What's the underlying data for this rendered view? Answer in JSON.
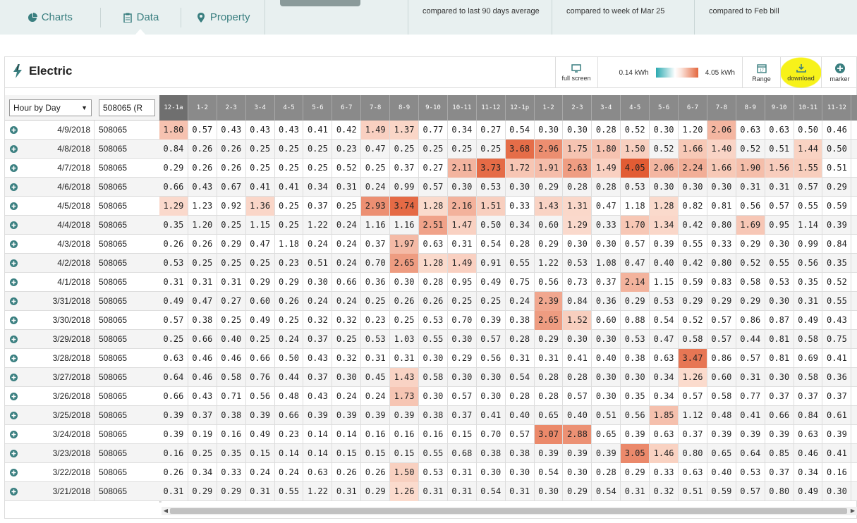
{
  "nav": {
    "tabs": [
      {
        "label": "Charts",
        "icon": "pie-chart-icon"
      },
      {
        "label": "Data",
        "icon": "clipboard-icon"
      },
      {
        "label": "Property",
        "icon": "location-pin-icon"
      }
    ],
    "active_tab": "Data"
  },
  "stats": [
    {
      "value": "",
      "caption": "compared to last 90 days average"
    },
    {
      "value": "",
      "caption": "compared to week of Mar 25"
    },
    {
      "value": "",
      "caption": "compared to Feb bill"
    }
  ],
  "panel": {
    "title": "Electric",
    "legend": {
      "min": "0.14 kWh",
      "max": "4.05 kWh",
      "low_color": "#2aa9b0",
      "high_color": "#e4673e"
    },
    "tools": {
      "fullscreen": "full screen",
      "range": "Range",
      "download": "download",
      "marker": "marker"
    }
  },
  "filters": {
    "view": "Hour by Day",
    "meter": "508065 (R"
  },
  "hours": [
    "12-1a",
    "1-2",
    "2-3",
    "3-4",
    "4-5",
    "5-6",
    "6-7",
    "7-8",
    "8-9",
    "9-10",
    "10-11",
    "11-12",
    "12-1p",
    "1-2",
    "2-3",
    "3-4",
    "4-5",
    "5-6",
    "6-7",
    "7-8",
    "8-9",
    "9-10",
    "10-11",
    "11-12"
  ],
  "rows": [
    {
      "date": "4/9/2018",
      "meter": "508065",
      "values": [
        "1.80",
        "0.57",
        "0.43",
        "0.43",
        "0.43",
        "0.41",
        "0.42",
        "1.49",
        "1.37",
        "0.77",
        "0.34",
        "0.27",
        "0.54",
        "0.30",
        "0.30",
        "0.28",
        "0.52",
        "0.30",
        "1.20",
        "2.06",
        "0.63",
        "0.63",
        "0.50",
        "0.46"
      ]
    },
    {
      "date": "4/8/2018",
      "meter": "508065",
      "values": [
        "0.84",
        "0.26",
        "0.26",
        "0.25",
        "0.25",
        "0.25",
        "0.23",
        "0.47",
        "0.25",
        "0.25",
        "0.25",
        "0.25",
        "3.68",
        "2.96",
        "1.75",
        "1.80",
        "1.50",
        "0.52",
        "1.66",
        "1.40",
        "0.52",
        "0.51",
        "1.44",
        "0.50"
      ]
    },
    {
      "date": "4/7/2018",
      "meter": "508065",
      "values": [
        "0.29",
        "0.26",
        "0.26",
        "0.25",
        "0.25",
        "0.25",
        "0.52",
        "0.25",
        "0.37",
        "0.27",
        "2.11",
        "3.73",
        "1.72",
        "1.91",
        "2.63",
        "1.49",
        "4.05",
        "2.06",
        "2.24",
        "1.66",
        "1.90",
        "1.56",
        "1.55",
        "0.51"
      ]
    },
    {
      "date": "4/6/2018",
      "meter": "508065",
      "values": [
        "0.66",
        "0.43",
        "0.67",
        "0.41",
        "0.41",
        "0.34",
        "0.31",
        "0.24",
        "0.99",
        "0.57",
        "0.30",
        "0.53",
        "0.30",
        "0.29",
        "0.28",
        "0.28",
        "0.53",
        "0.30",
        "0.30",
        "0.30",
        "0.31",
        "0.31",
        "0.57",
        "0.29"
      ]
    },
    {
      "date": "4/5/2018",
      "meter": "508065",
      "values": [
        "1.29",
        "1.23",
        "0.92",
        "1.36",
        "0.25",
        "0.37",
        "0.25",
        "2.93",
        "3.74",
        "1.28",
        "2.16",
        "1.51",
        "0.33",
        "1.43",
        "1.31",
        "0.47",
        "1.18",
        "1.28",
        "0.82",
        "0.81",
        "0.56",
        "0.57",
        "0.55",
        "0.59"
      ]
    },
    {
      "date": "4/4/2018",
      "meter": "508065",
      "values": [
        "0.35",
        "1.20",
        "0.25",
        "1.15",
        "0.25",
        "1.22",
        "0.24",
        "1.16",
        "1.16",
        "2.51",
        "1.47",
        "0.50",
        "0.34",
        "0.60",
        "1.29",
        "0.33",
        "1.70",
        "1.34",
        "0.42",
        "0.80",
        "1.69",
        "0.95",
        "1.14",
        "0.39"
      ]
    },
    {
      "date": "4/3/2018",
      "meter": "508065",
      "values": [
        "0.26",
        "0.26",
        "0.29",
        "0.47",
        "1.18",
        "0.24",
        "0.24",
        "0.37",
        "1.97",
        "0.63",
        "0.31",
        "0.54",
        "0.28",
        "0.29",
        "0.30",
        "0.30",
        "0.57",
        "0.39",
        "0.55",
        "0.33",
        "0.29",
        "0.30",
        "0.99",
        "0.84"
      ]
    },
    {
      "date": "4/2/2018",
      "meter": "508065",
      "values": [
        "0.53",
        "0.25",
        "0.25",
        "0.25",
        "0.23",
        "0.51",
        "0.24",
        "0.70",
        "2.65",
        "1.28",
        "1.49",
        "0.91",
        "0.55",
        "1.22",
        "0.53",
        "1.08",
        "0.47",
        "0.40",
        "0.42",
        "0.80",
        "0.52",
        "0.55",
        "0.56",
        "0.35"
      ]
    },
    {
      "date": "4/1/2018",
      "meter": "508065",
      "values": [
        "0.31",
        "0.31",
        "0.31",
        "0.29",
        "0.29",
        "0.30",
        "0.66",
        "0.36",
        "0.30",
        "0.28",
        "0.95",
        "0.49",
        "0.75",
        "0.56",
        "0.73",
        "0.37",
        "2.14",
        "1.15",
        "0.59",
        "0.83",
        "0.58",
        "0.53",
        "0.35",
        "0.52"
      ]
    },
    {
      "date": "3/31/2018",
      "meter": "508065",
      "values": [
        "0.49",
        "0.47",
        "0.27",
        "0.60",
        "0.26",
        "0.24",
        "0.24",
        "0.25",
        "0.26",
        "0.26",
        "0.25",
        "0.25",
        "0.24",
        "2.39",
        "0.84",
        "0.36",
        "0.29",
        "0.53",
        "0.29",
        "0.29",
        "0.29",
        "0.30",
        "0.31",
        "0.55"
      ]
    },
    {
      "date": "3/30/2018",
      "meter": "508065",
      "values": [
        "0.57",
        "0.38",
        "0.25",
        "0.49",
        "0.25",
        "0.32",
        "0.32",
        "0.23",
        "0.25",
        "0.53",
        "0.70",
        "0.39",
        "0.38",
        "2.65",
        "1.52",
        "0.60",
        "0.88",
        "0.54",
        "0.52",
        "0.57",
        "0.86",
        "0.87",
        "0.49",
        "0.43"
      ]
    },
    {
      "date": "3/29/2018",
      "meter": "508065",
      "values": [
        "0.25",
        "0.66",
        "0.40",
        "0.25",
        "0.24",
        "0.37",
        "0.25",
        "0.53",
        "1.03",
        "0.55",
        "0.30",
        "0.57",
        "0.28",
        "0.29",
        "0.30",
        "0.30",
        "0.53",
        "0.47",
        "0.58",
        "0.57",
        "0.44",
        "0.81",
        "0.58",
        "0.75"
      ]
    },
    {
      "date": "3/28/2018",
      "meter": "508065",
      "values": [
        "0.63",
        "0.46",
        "0.46",
        "0.66",
        "0.50",
        "0.43",
        "0.32",
        "0.31",
        "0.31",
        "0.30",
        "0.29",
        "0.56",
        "0.31",
        "0.31",
        "0.41",
        "0.40",
        "0.38",
        "0.63",
        "3.47",
        "0.86",
        "0.57",
        "0.81",
        "0.69",
        "0.41"
      ]
    },
    {
      "date": "3/27/2018",
      "meter": "508065",
      "values": [
        "0.64",
        "0.46",
        "0.58",
        "0.76",
        "0.44",
        "0.37",
        "0.30",
        "0.45",
        "1.43",
        "0.58",
        "0.30",
        "0.30",
        "0.54",
        "0.28",
        "0.28",
        "0.30",
        "0.30",
        "0.34",
        "1.26",
        "0.60",
        "0.31",
        "0.30",
        "0.58",
        "0.36"
      ]
    },
    {
      "date": "3/26/2018",
      "meter": "508065",
      "values": [
        "0.66",
        "0.43",
        "0.71",
        "0.56",
        "0.48",
        "0.43",
        "0.24",
        "0.24",
        "1.73",
        "0.30",
        "0.57",
        "0.30",
        "0.28",
        "0.28",
        "0.57",
        "0.30",
        "0.35",
        "0.34",
        "0.57",
        "0.58",
        "0.77",
        "0.37",
        "0.37",
        "0.37"
      ]
    },
    {
      "date": "3/25/2018",
      "meter": "508065",
      "values": [
        "0.39",
        "0.37",
        "0.38",
        "0.39",
        "0.66",
        "0.39",
        "0.39",
        "0.39",
        "0.39",
        "0.38",
        "0.37",
        "0.41",
        "0.40",
        "0.65",
        "0.40",
        "0.51",
        "0.56",
        "1.85",
        "1.12",
        "0.48",
        "0.41",
        "0.66",
        "0.84",
        "0.61"
      ]
    },
    {
      "date": "3/24/2018",
      "meter": "508065",
      "values": [
        "0.39",
        "0.19",
        "0.16",
        "0.49",
        "0.23",
        "0.14",
        "0.14",
        "0.16",
        "0.16",
        "0.16",
        "0.15",
        "0.70",
        "0.57",
        "3.07",
        "2.88",
        "0.65",
        "0.39",
        "0.63",
        "0.37",
        "0.39",
        "0.39",
        "0.39",
        "0.63",
        "0.39"
      ]
    },
    {
      "date": "3/23/2018",
      "meter": "508065",
      "values": [
        "0.16",
        "0.25",
        "0.35",
        "0.15",
        "0.14",
        "0.14",
        "0.15",
        "0.15",
        "0.15",
        "0.55",
        "0.68",
        "0.38",
        "0.38",
        "0.39",
        "0.39",
        "0.39",
        "3.05",
        "1.46",
        "0.80",
        "0.65",
        "0.64",
        "0.85",
        "0.46",
        "0.41"
      ]
    },
    {
      "date": "3/22/2018",
      "meter": "508065",
      "values": [
        "0.26",
        "0.34",
        "0.33",
        "0.24",
        "0.24",
        "0.63",
        "0.26",
        "0.26",
        "1.50",
        "0.53",
        "0.31",
        "0.30",
        "0.30",
        "0.54",
        "0.30",
        "0.28",
        "0.29",
        "0.33",
        "0.63",
        "0.40",
        "0.53",
        "0.37",
        "0.34",
        "0.16"
      ]
    },
    {
      "date": "3/21/2018",
      "meter": "508065",
      "values": [
        "0.31",
        "0.29",
        "0.29",
        "0.31",
        "0.55",
        "1.22",
        "0.31",
        "0.29",
        "1.26",
        "0.31",
        "0.31",
        "0.54",
        "0.31",
        "0.30",
        "0.29",
        "0.54",
        "0.31",
        "0.32",
        "0.51",
        "0.59",
        "0.57",
        "0.80",
        "0.49",
        "0.30"
      ]
    }
  ]
}
